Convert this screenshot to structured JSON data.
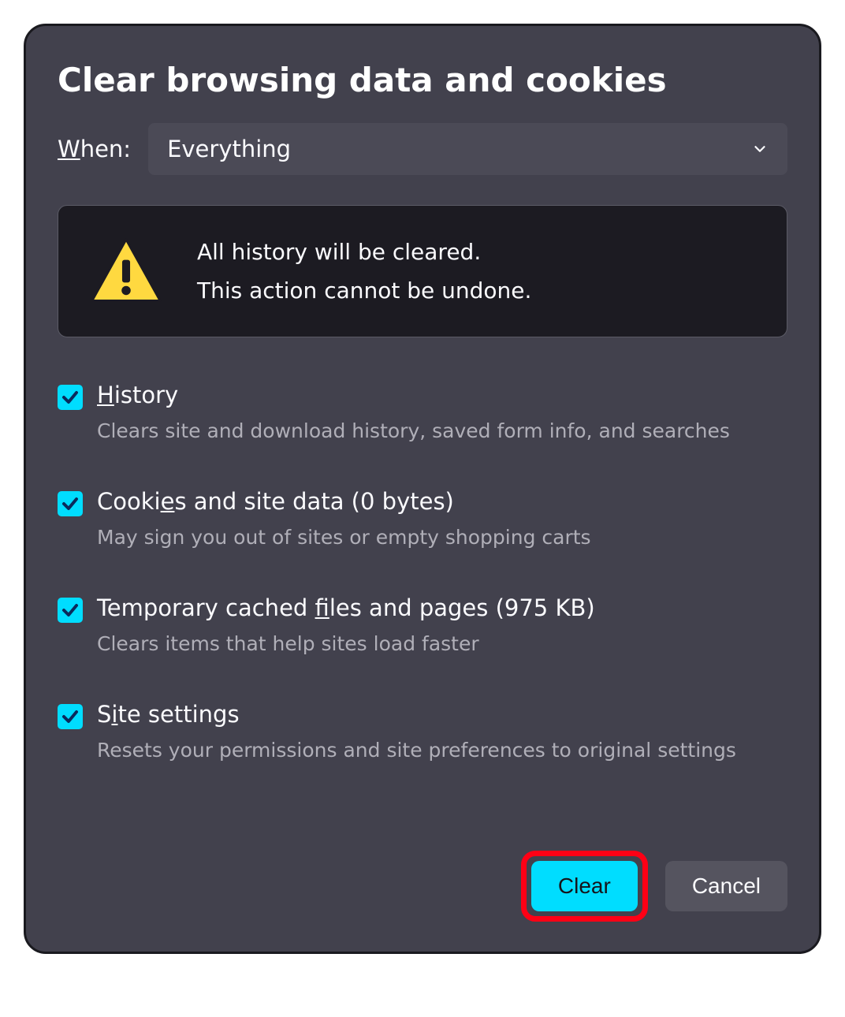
{
  "dialog": {
    "title": "Clear browsing data and cookies",
    "when_label_pre": "W",
    "when_label_post": "hen:",
    "dropdown_value": "Everything",
    "warning_line1": "All history will be cleared.",
    "warning_line2": "This action cannot be undone."
  },
  "options": [
    {
      "checked": true,
      "pre": "",
      "accel": "H",
      "post": "istory",
      "desc": "Clears site and download history, saved form info, and searches"
    },
    {
      "checked": true,
      "pre": "Cooki",
      "accel": "e",
      "post": "s and site data (0 bytes)",
      "desc": "May sign you out of sites or empty shopping carts"
    },
    {
      "checked": true,
      "pre": "Temporary cached ",
      "accel": "f",
      "post": "iles and pages (975 KB)",
      "desc": "Clears items that help sites load faster"
    },
    {
      "checked": true,
      "pre": "S",
      "accel": "i",
      "post": "te settings",
      "desc": "Resets your permissions and site preferences to original settings"
    }
  ],
  "buttons": {
    "clear": "Clear",
    "cancel": "Cancel"
  }
}
